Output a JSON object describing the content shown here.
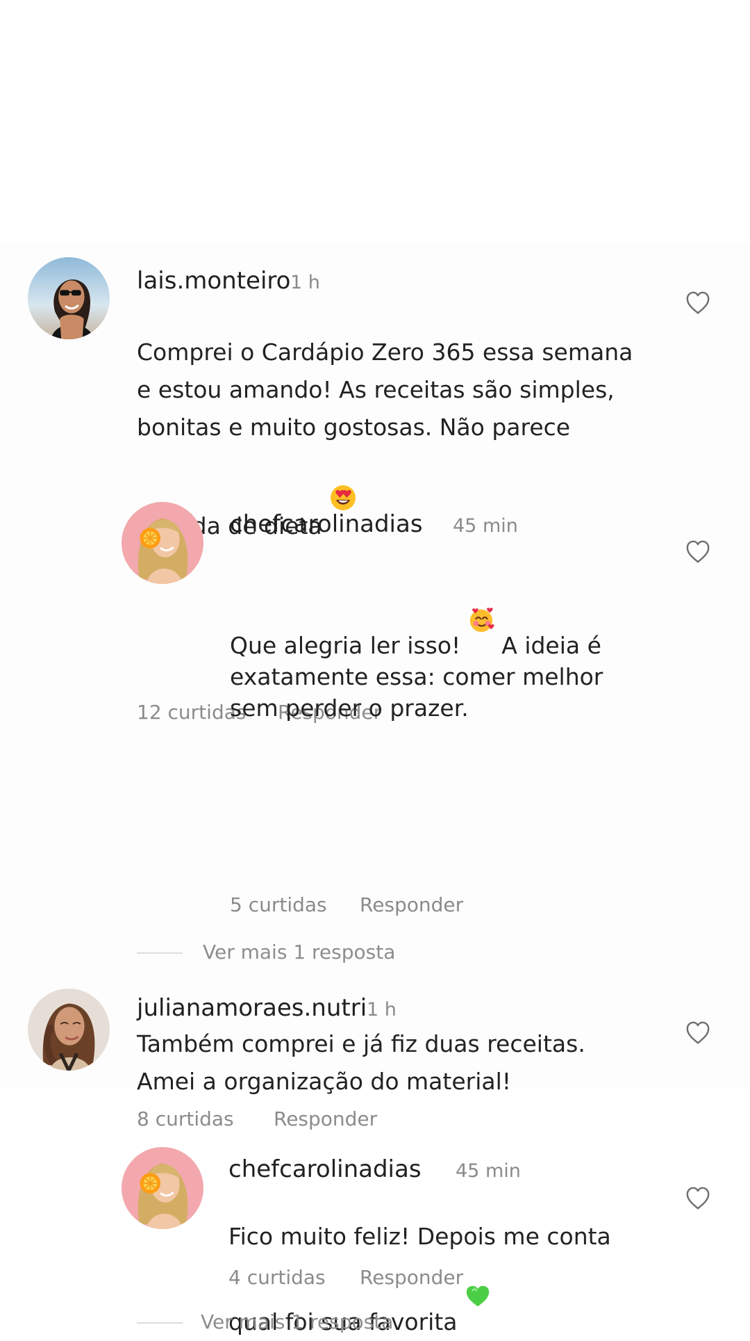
{
  "comments": [
    {
      "username": "lais.monteiro",
      "time": "1 h",
      "text_before_emoji": "Comprei o Cardápio Zero 365 essa semana\ne estou amando! As receitas são simples,\nbonitas e muito gostosas. Não parece\ncomida de dieta ",
      "emoji": "heart-eyes-emoji",
      "likes": "12 curtidas",
      "reply_label": "Responder",
      "view_more": "Ver mais 1 resposta",
      "reply": {
        "username": "chefcarolinadias",
        "time": "45 min",
        "text_before_emoji": "Que alegria ler isso! ",
        "emoji": "smiling-face-with-hearts-emoji",
        "text_after_emoji": " A ideia é\nexatamente essa: comer melhor\nsem perder o prazer.",
        "likes": "5 curtidas",
        "reply_label": "Responder"
      }
    },
    {
      "username": "julianamoraes.nutri",
      "time": "1 h",
      "text": "Também comprei e já fiz duas receitas.\nAmei a organização do material!",
      "likes": "8 curtidas",
      "reply_label": "Responder",
      "view_more": "Ver mais 1 resposta",
      "reply": {
        "username": "chefcarolinadias",
        "time": "45 min",
        "text_before_emoji": "Fico muito feliz! Depois me conta\nqual foi sua favorita ",
        "emoji": "green-heart-emoji",
        "likes": "4 curtidas",
        "reply_label": "Responder"
      }
    }
  ],
  "icons": {
    "like": "heart-outline-icon"
  },
  "colors": {
    "background": "#ffffff",
    "card": "#fdfdfd",
    "text": "#222222",
    "muted": "#8b8b8b",
    "heart": "#6f6f6f"
  }
}
